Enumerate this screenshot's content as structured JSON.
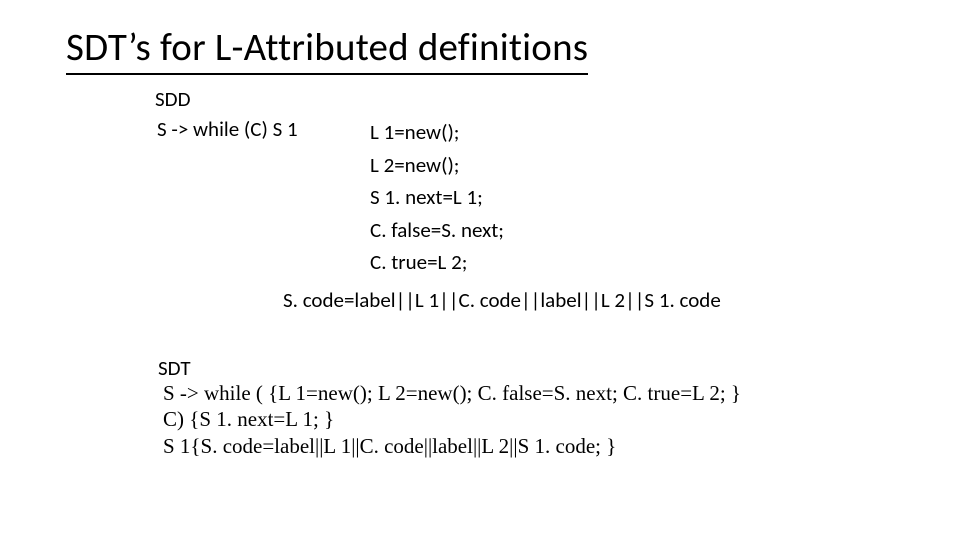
{
  "title": "SDT’s for L-Attributed definitions",
  "sdd": {
    "label": "SDD",
    "production": "S -> while (C) S 1",
    "rules": [
      "L 1=new();",
      "L 2=new();",
      "S 1. next=L 1;",
      "C. false=S. next;",
      "C. true=L 2;"
    ],
    "long_rule": "S. code=label||L 1||C. code||label||L 2||S 1. code"
  },
  "sdt": {
    "label": "SDT",
    "lines": [
      "S -> while ( {L 1=new(); L 2=new(); C. false=S. next; C. true=L 2; }",
      "C) {S 1. next=L 1; }",
      "S 1{S. code=label||L 1||C. code||label||L 2||S 1. code; }"
    ]
  }
}
